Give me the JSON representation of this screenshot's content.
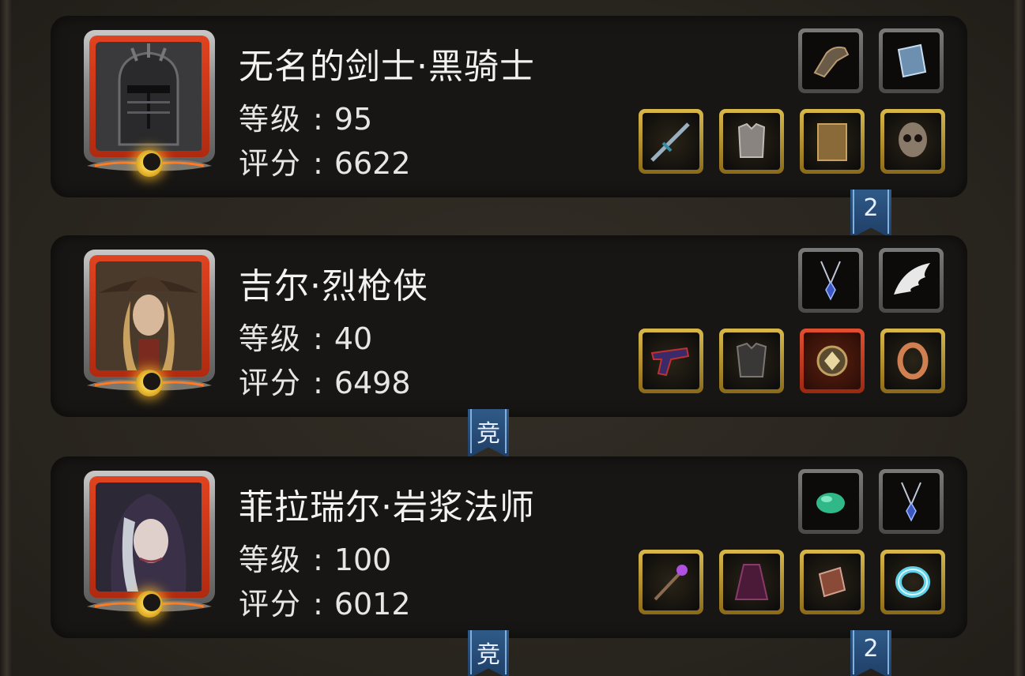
{
  "characters": [
    {
      "name": "无名的剑士·黑骑士",
      "level_label": "等级",
      "level": "95",
      "score_label": "评分",
      "score": "6622",
      "portrait_icon": "dark-knight-helmet-portrait",
      "top_slots": [
        {
          "icon": "gauntlet-icon",
          "frame": "gray"
        },
        {
          "icon": "book-icon",
          "frame": "gray"
        }
      ],
      "bottom_slots": [
        {
          "icon": "sword-icon",
          "frame": "gold"
        },
        {
          "icon": "chest-armor-icon",
          "frame": "gold"
        },
        {
          "icon": "scroll-icon",
          "frame": "gold"
        },
        {
          "icon": "skull-mask-icon",
          "frame": "gold"
        }
      ]
    },
    {
      "name": "吉尔·烈枪侠",
      "level_label": "等级",
      "level": "40",
      "score_label": "评分",
      "score": "6498",
      "portrait_icon": "gunslinger-woman-portrait",
      "top_slots": [
        {
          "icon": "necklace-icon",
          "frame": "gray"
        },
        {
          "icon": "wing-icon",
          "frame": "gray"
        }
      ],
      "bottom_slots": [
        {
          "icon": "pistol-icon",
          "frame": "gold"
        },
        {
          "icon": "dark-armor-icon",
          "frame": "gold"
        },
        {
          "icon": "amulet-icon",
          "frame": "red"
        },
        {
          "icon": "ring-icon",
          "frame": "gold"
        }
      ]
    },
    {
      "name": "菲拉瑞尔·岩浆法师",
      "level_label": "等级",
      "level": "100",
      "score_label": "评分",
      "score": "6012",
      "portrait_icon": "hooded-mage-portrait",
      "top_slots": [
        {
          "icon": "jade-gem-icon",
          "frame": "gray"
        },
        {
          "icon": "necklace-icon",
          "frame": "gray"
        }
      ],
      "bottom_slots": [
        {
          "icon": "staff-icon",
          "frame": "gold"
        },
        {
          "icon": "robe-icon",
          "frame": "gold"
        },
        {
          "icon": "bracer-icon",
          "frame": "gold"
        },
        {
          "icon": "ice-ring-icon",
          "frame": "gold"
        }
      ]
    }
  ],
  "ribbons": [
    {
      "text": "2"
    },
    {
      "text": "竞"
    },
    {
      "text": "竞"
    },
    {
      "text": "2"
    }
  ],
  "colors": {
    "ribbon_blue": "#2f5a88",
    "portrait_red": "#d43a1a",
    "slot_gold": "#c9a63a"
  }
}
